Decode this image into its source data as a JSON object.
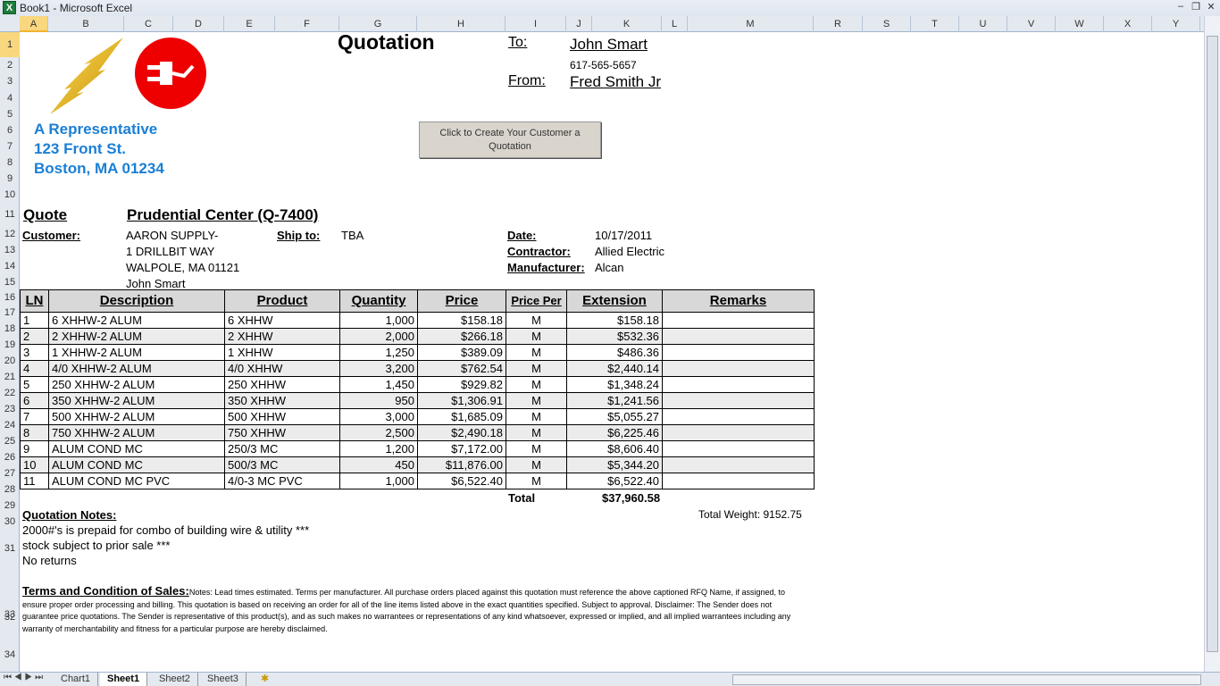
{
  "window": {
    "title": "Book1 - Microsoft Excel"
  },
  "columns": [
    "A",
    "B",
    "C",
    "D",
    "E",
    "F",
    "G",
    "H",
    "I",
    "J",
    "K",
    "L",
    "M",
    "R",
    "S",
    "T",
    "U",
    "V",
    "W",
    "X",
    "Y"
  ],
  "rows": [
    "1",
    "2",
    "3",
    "4",
    "5",
    "6",
    "7",
    "8",
    "9",
    "10",
    "11",
    "12",
    "13",
    "14",
    "15",
    "16",
    "17",
    "18",
    "19",
    "20",
    "21",
    "22",
    "23",
    "24",
    "25",
    "26",
    "27",
    "28",
    "29",
    "30",
    "31",
    "32",
    "33",
    "34"
  ],
  "header": {
    "title": "Quotation",
    "to_label": "To:",
    "to_name": "John Smart",
    "to_phone": "617-565-5657",
    "from_label": "From:",
    "from_name": "Fred Smith Jr"
  },
  "company": {
    "name": "A Representative",
    "street": "123 Front St.",
    "city": "Boston, MA 01234"
  },
  "button": {
    "label": "Click to Create Your Customer a Quotation"
  },
  "quote": {
    "label": "Quote",
    "name": "Prudential Center (Q-7400)",
    "customer_label": "Customer:",
    "customer_lines": [
      "AARON SUPPLY-",
      "1 DRILLBIT WAY",
      "WALPOLE, MA 01121",
      "John Smart"
    ],
    "ship_label": "Ship to:",
    "ship_value": "TBA",
    "date_label": "Date:",
    "date_value": "10/17/2011",
    "contractor_label": "Contractor:",
    "contractor_value": "Allied Electric",
    "manufacturer_label": "Manufacturer:",
    "manufacturer_value": "Alcan"
  },
  "table": {
    "headers": [
      "LN",
      "Description",
      "Product",
      "Quantity",
      "Price",
      "Price Per",
      "Extension",
      "Remarks"
    ],
    "rows": [
      [
        "1",
        "6 XHHW-2 ALUM",
        "6 XHHW",
        "1,000",
        "$158.18",
        "M",
        "$158.18",
        ""
      ],
      [
        "2",
        "2 XHHW-2 ALUM",
        "2 XHHW",
        "2,000",
        "$266.18",
        "M",
        "$532.36",
        ""
      ],
      [
        "3",
        "1 XHHW-2 ALUM",
        "1 XHHW",
        "1,250",
        "$389.09",
        "M",
        "$486.36",
        ""
      ],
      [
        "4",
        "4/0 XHHW-2 ALUM",
        "4/0 XHHW",
        "3,200",
        "$762.54",
        "M",
        "$2,440.14",
        ""
      ],
      [
        "5",
        "250 XHHW-2 ALUM",
        "250 XHHW",
        "1,450",
        "$929.82",
        "M",
        "$1,348.24",
        ""
      ],
      [
        "6",
        "350 XHHW-2 ALUM",
        "350 XHHW",
        "950",
        "$1,306.91",
        "M",
        "$1,241.56",
        ""
      ],
      [
        "7",
        "500 XHHW-2 ALUM",
        "500 XHHW",
        "3,000",
        "$1,685.09",
        "M",
        "$5,055.27",
        ""
      ],
      [
        "8",
        "750 XHHW-2 ALUM",
        "750 XHHW",
        "2,500",
        "$2,490.18",
        "M",
        "$6,225.46",
        ""
      ],
      [
        "9",
        "ALUM COND MC",
        "250/3 MC",
        "1,200",
        "$7,172.00",
        "M",
        "$8,606.40",
        ""
      ],
      [
        "10",
        "ALUM COND MC",
        "500/3 MC",
        "450",
        "$11,876.00",
        "M",
        "$5,344.20",
        ""
      ],
      [
        "11",
        "ALUM COND MC PVC",
        "4/0-3 MC PVC",
        "1,000",
        "$6,522.40",
        "M",
        "$6,522.40",
        ""
      ]
    ],
    "total_label": "Total",
    "total_value": "$37,960.58",
    "total_weight": "Total Weight: 9152.75"
  },
  "notes": {
    "label": "Quotation Notes:",
    "lines": [
      "2000#'s is prepaid for combo of building wire & utility ***",
      "stock subject to prior sale ***",
      "No returns"
    ]
  },
  "terms": {
    "label": "Terms and Condition of Sales:",
    "text": "Notes: Lead times estimated. Terms per manufacturer. All purchase orders placed against this quotation must reference the above captioned RFQ Name, if assigned, to ensure proper order processing and billing. This quotation is based on receiving an order for all of the line items listed above in the exact quantities specified. Subject to approval. Disclaimer: The Sender does not guarantee price quotations. The Sender is representative of this product(s), and as such makes no warrantees or representations of any kind whatsoever, expressed or implied, and all implied warrantees including any warranty of merchantability and fitness for a particular purpose are hereby disclaimed."
  },
  "sheets": [
    "Chart1",
    "Sheet1",
    "Sheet2",
    "Sheet3"
  ],
  "active_sheet": "Sheet1"
}
